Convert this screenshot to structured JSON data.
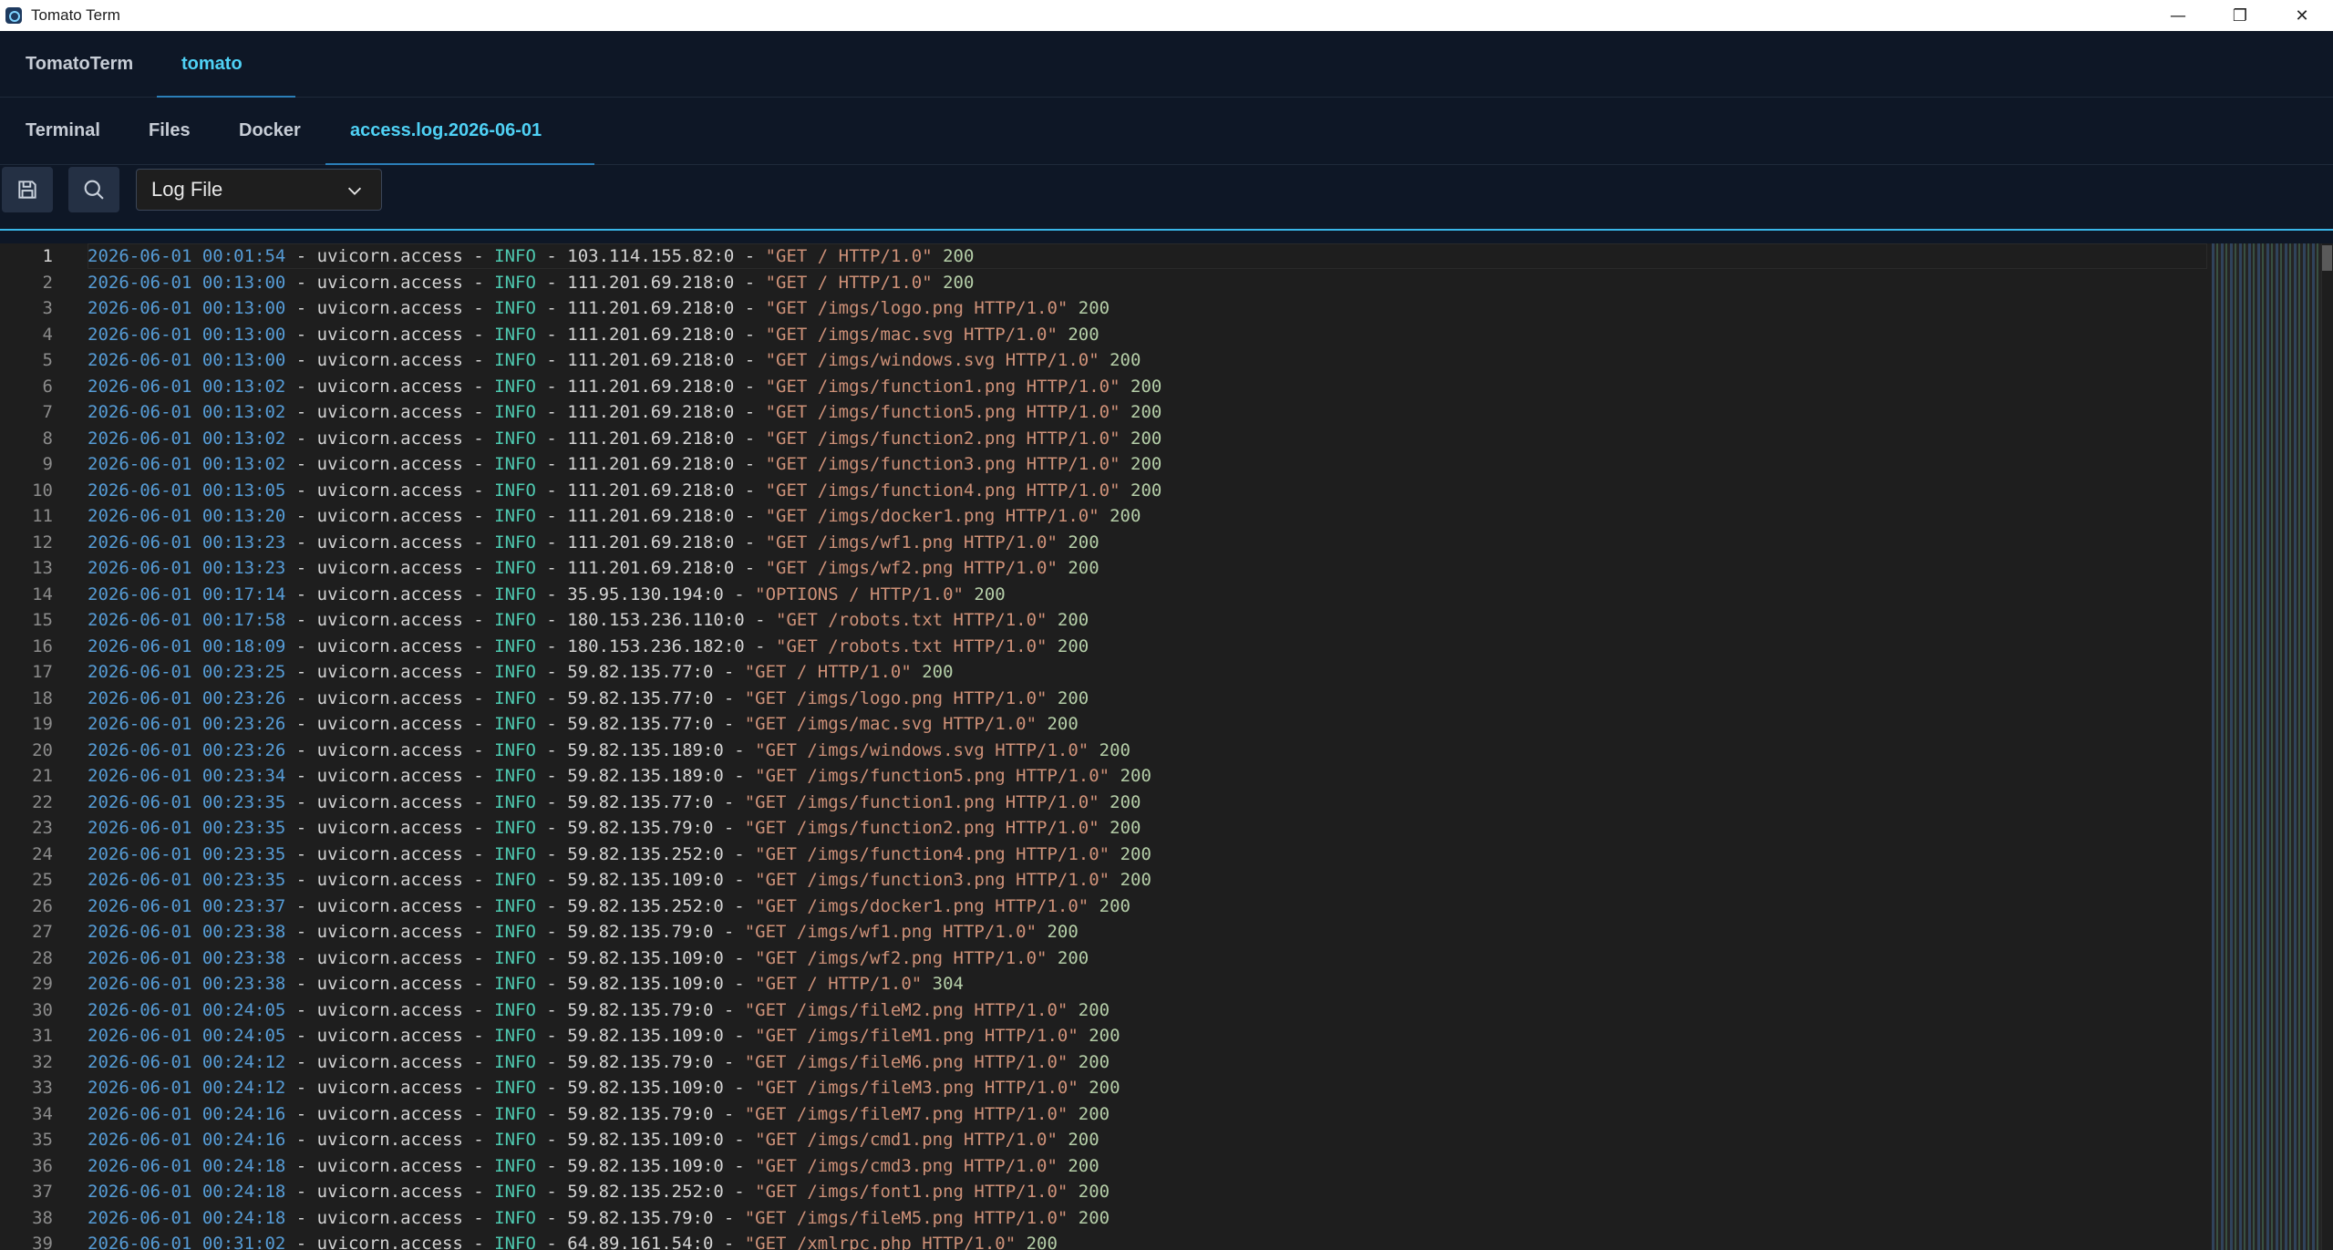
{
  "window": {
    "title": "Tomato Term",
    "controls": {
      "minimize": "—",
      "maximize": "❐",
      "close": "✕"
    }
  },
  "app_tabs": [
    {
      "label": "TomatoTerm",
      "active": false
    },
    {
      "label": "tomato",
      "active": true
    }
  ],
  "sub_tabs": [
    {
      "label": "Terminal",
      "active": false
    },
    {
      "label": "Files",
      "active": false
    },
    {
      "label": "Docker",
      "active": false
    },
    {
      "label": "access.log.2026-06-01",
      "active": true
    }
  ],
  "toolbar": {
    "save_icon": "save-icon",
    "search_icon": "search-icon",
    "language_select": "Log File"
  },
  "colors": {
    "accent": "#4fd1f5",
    "date": "#569cd6",
    "info": "#4ec9b0",
    "request": "#ce9178",
    "status": "#b5cea8"
  },
  "editor": {
    "current_line": 1,
    "lines": [
      {
        "n": "1",
        "date": "2026-06-01 00:01:54",
        "ip": "103.114.155.82:0",
        "req": "\"GET / HTTP/1.0\"",
        "status": "200"
      },
      {
        "n": "2",
        "date": "2026-06-01 00:13:00",
        "ip": "111.201.69.218:0",
        "req": "\"GET / HTTP/1.0\"",
        "status": "200"
      },
      {
        "n": "3",
        "date": "2026-06-01 00:13:00",
        "ip": "111.201.69.218:0",
        "req": "\"GET /imgs/logo.png HTTP/1.0\"",
        "status": "200"
      },
      {
        "n": "4",
        "date": "2026-06-01 00:13:00",
        "ip": "111.201.69.218:0",
        "req": "\"GET /imgs/mac.svg HTTP/1.0\"",
        "status": "200"
      },
      {
        "n": "5",
        "date": "2026-06-01 00:13:00",
        "ip": "111.201.69.218:0",
        "req": "\"GET /imgs/windows.svg HTTP/1.0\"",
        "status": "200"
      },
      {
        "n": "6",
        "date": "2026-06-01 00:13:02",
        "ip": "111.201.69.218:0",
        "req": "\"GET /imgs/function1.png HTTP/1.0\"",
        "status": "200"
      },
      {
        "n": "7",
        "date": "2026-06-01 00:13:02",
        "ip": "111.201.69.218:0",
        "req": "\"GET /imgs/function5.png HTTP/1.0\"",
        "status": "200"
      },
      {
        "n": "8",
        "date": "2026-06-01 00:13:02",
        "ip": "111.201.69.218:0",
        "req": "\"GET /imgs/function2.png HTTP/1.0\"",
        "status": "200"
      },
      {
        "n": "9",
        "date": "2026-06-01 00:13:02",
        "ip": "111.201.69.218:0",
        "req": "\"GET /imgs/function3.png HTTP/1.0\"",
        "status": "200"
      },
      {
        "n": "10",
        "date": "2026-06-01 00:13:05",
        "ip": "111.201.69.218:0",
        "req": "\"GET /imgs/function4.png HTTP/1.0\"",
        "status": "200"
      },
      {
        "n": "11",
        "date": "2026-06-01 00:13:20",
        "ip": "111.201.69.218:0",
        "req": "\"GET /imgs/docker1.png HTTP/1.0\"",
        "status": "200"
      },
      {
        "n": "12",
        "date": "2026-06-01 00:13:23",
        "ip": "111.201.69.218:0",
        "req": "\"GET /imgs/wf1.png HTTP/1.0\"",
        "status": "200"
      },
      {
        "n": "13",
        "date": "2026-06-01 00:13:23",
        "ip": "111.201.69.218:0",
        "req": "\"GET /imgs/wf2.png HTTP/1.0\"",
        "status": "200"
      },
      {
        "n": "14",
        "date": "2026-06-01 00:17:14",
        "ip": "35.95.130.194:0",
        "req": "\"OPTIONS / HTTP/1.0\"",
        "status": "200"
      },
      {
        "n": "15",
        "date": "2026-06-01 00:17:58",
        "ip": "180.153.236.110:0",
        "req": "\"GET /robots.txt HTTP/1.0\"",
        "status": "200"
      },
      {
        "n": "16",
        "date": "2026-06-01 00:18:09",
        "ip": "180.153.236.182:0",
        "req": "\"GET /robots.txt HTTP/1.0\"",
        "status": "200"
      },
      {
        "n": "17",
        "date": "2026-06-01 00:23:25",
        "ip": "59.82.135.77:0",
        "req": "\"GET / HTTP/1.0\"",
        "status": "200"
      },
      {
        "n": "18",
        "date": "2026-06-01 00:23:26",
        "ip": "59.82.135.77:0",
        "req": "\"GET /imgs/logo.png HTTP/1.0\"",
        "status": "200"
      },
      {
        "n": "19",
        "date": "2026-06-01 00:23:26",
        "ip": "59.82.135.77:0",
        "req": "\"GET /imgs/mac.svg HTTP/1.0\"",
        "status": "200"
      },
      {
        "n": "20",
        "date": "2026-06-01 00:23:26",
        "ip": "59.82.135.189:0",
        "req": "\"GET /imgs/windows.svg HTTP/1.0\"",
        "status": "200"
      },
      {
        "n": "21",
        "date": "2026-06-01 00:23:34",
        "ip": "59.82.135.189:0",
        "req": "\"GET /imgs/function5.png HTTP/1.0\"",
        "status": "200"
      },
      {
        "n": "22",
        "date": "2026-06-01 00:23:35",
        "ip": "59.82.135.77:0",
        "req": "\"GET /imgs/function1.png HTTP/1.0\"",
        "status": "200"
      },
      {
        "n": "23",
        "date": "2026-06-01 00:23:35",
        "ip": "59.82.135.79:0",
        "req": "\"GET /imgs/function2.png HTTP/1.0\"",
        "status": "200"
      },
      {
        "n": "24",
        "date": "2026-06-01 00:23:35",
        "ip": "59.82.135.252:0",
        "req": "\"GET /imgs/function4.png HTTP/1.0\"",
        "status": "200"
      },
      {
        "n": "25",
        "date": "2026-06-01 00:23:35",
        "ip": "59.82.135.109:0",
        "req": "\"GET /imgs/function3.png HTTP/1.0\"",
        "status": "200"
      },
      {
        "n": "26",
        "date": "2026-06-01 00:23:37",
        "ip": "59.82.135.252:0",
        "req": "\"GET /imgs/docker1.png HTTP/1.0\"",
        "status": "200"
      },
      {
        "n": "27",
        "date": "2026-06-01 00:23:38",
        "ip": "59.82.135.79:0",
        "req": "\"GET /imgs/wf1.png HTTP/1.0\"",
        "status": "200"
      },
      {
        "n": "28",
        "date": "2026-06-01 00:23:38",
        "ip": "59.82.135.109:0",
        "req": "\"GET /imgs/wf2.png HTTP/1.0\"",
        "status": "200"
      },
      {
        "n": "29",
        "date": "2026-06-01 00:23:38",
        "ip": "59.82.135.109:0",
        "req": "\"GET / HTTP/1.0\"",
        "status": "304"
      },
      {
        "n": "30",
        "date": "2026-06-01 00:24:05",
        "ip": "59.82.135.79:0",
        "req": "\"GET /imgs/fileM2.png HTTP/1.0\"",
        "status": "200"
      },
      {
        "n": "31",
        "date": "2026-06-01 00:24:05",
        "ip": "59.82.135.109:0",
        "req": "\"GET /imgs/fileM1.png HTTP/1.0\"",
        "status": "200"
      },
      {
        "n": "32",
        "date": "2026-06-01 00:24:12",
        "ip": "59.82.135.79:0",
        "req": "\"GET /imgs/fileM6.png HTTP/1.0\"",
        "status": "200"
      },
      {
        "n": "33",
        "date": "2026-06-01 00:24:12",
        "ip": "59.82.135.109:0",
        "req": "\"GET /imgs/fileM3.png HTTP/1.0\"",
        "status": "200"
      },
      {
        "n": "34",
        "date": "2026-06-01 00:24:16",
        "ip": "59.82.135.79:0",
        "req": "\"GET /imgs/fileM7.png HTTP/1.0\"",
        "status": "200"
      },
      {
        "n": "35",
        "date": "2026-06-01 00:24:16",
        "ip": "59.82.135.109:0",
        "req": "\"GET /imgs/cmd1.png HTTP/1.0\"",
        "status": "200"
      },
      {
        "n": "36",
        "date": "2026-06-01 00:24:18",
        "ip": "59.82.135.109:0",
        "req": "\"GET /imgs/cmd3.png HTTP/1.0\"",
        "status": "200"
      },
      {
        "n": "37",
        "date": "2026-06-01 00:24:18",
        "ip": "59.82.135.252:0",
        "req": "\"GET /imgs/font1.png HTTP/1.0\"",
        "status": "200"
      },
      {
        "n": "38",
        "date": "2026-06-01 00:24:18",
        "ip": "59.82.135.79:0",
        "req": "\"GET /imgs/fileM5.png HTTP/1.0\"",
        "status": "200"
      },
      {
        "n": "39",
        "date": "2026-06-01 00:31:02",
        "ip": "64.89.161.54:0",
        "req": "\"GET /xmlrpc.php HTTP/1.0\"",
        "status": "200"
      }
    ],
    "source": "uvicorn.access",
    "level": "INFO",
    "sep": " - "
  }
}
